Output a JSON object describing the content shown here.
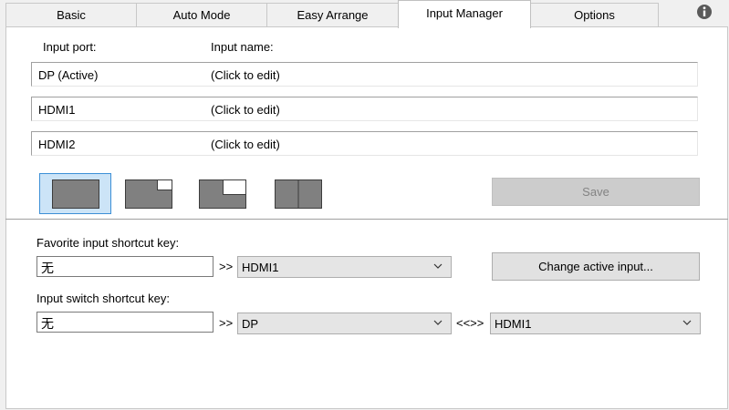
{
  "tabs": [
    {
      "label": "Basic",
      "active": false
    },
    {
      "label": "Auto Mode",
      "active": false
    },
    {
      "label": "Easy Arrange",
      "active": false
    },
    {
      "label": "Input Manager",
      "active": true
    },
    {
      "label": "Options",
      "active": false
    }
  ],
  "headers": {
    "port": "Input port:",
    "name": "Input name:"
  },
  "inputs": [
    {
      "port": "DP (Active)",
      "name": "(Click to edit)"
    },
    {
      "port": "HDMI1",
      "name": "(Click to edit)"
    },
    {
      "port": "HDMI2",
      "name": "(Click to edit)"
    }
  ],
  "layouts": [
    {
      "icon": "single-layout-icon",
      "selected": true
    },
    {
      "icon": "pip-small-layout-icon",
      "selected": false
    },
    {
      "icon": "pip-large-layout-icon",
      "selected": false
    },
    {
      "icon": "split-layout-icon",
      "selected": false
    }
  ],
  "save_label": "Save",
  "favorite": {
    "label": "Favorite input shortcut key:",
    "key_value": "无",
    "arrow": ">>",
    "selected": "HDMI1",
    "change_label": "Change active input..."
  },
  "switch": {
    "label": "Input switch shortcut key:",
    "key_value": "无",
    "arrow": ">>",
    "from": "DP",
    "swap": "<<>>",
    "to": "HDMI1"
  },
  "colors": {
    "accent_selected_bg": "#cce4f7",
    "accent_selected_border": "#3c8fd6",
    "monitor_gray": "#808080"
  }
}
